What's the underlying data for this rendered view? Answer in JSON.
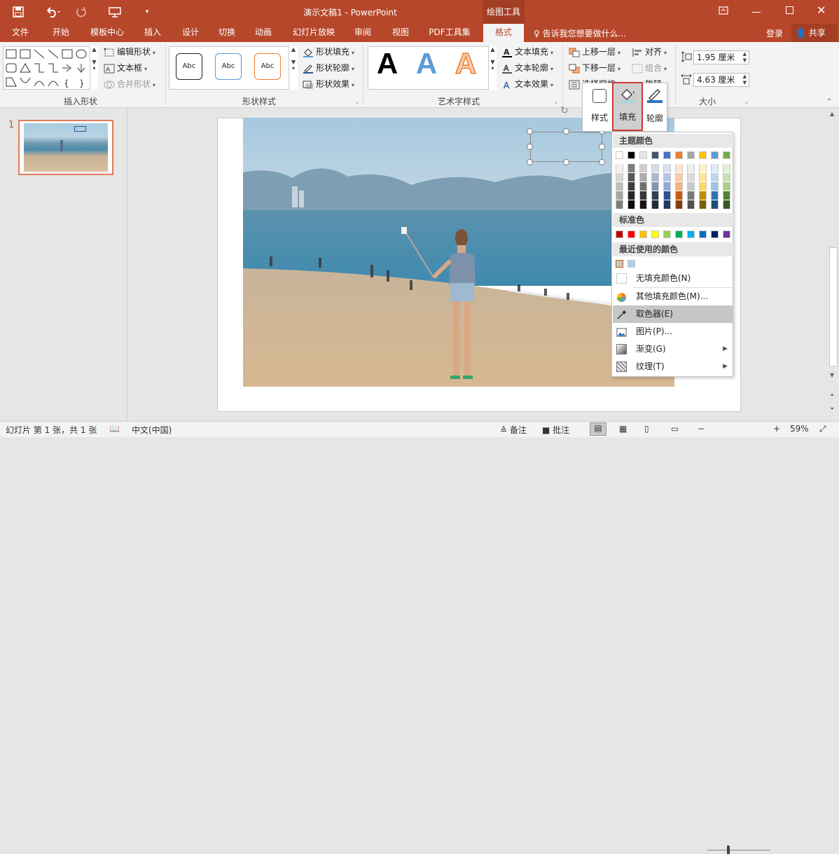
{
  "window": {
    "title": "演示文稿1 - PowerPoint",
    "context_tab": "绘图工具"
  },
  "quick_access": {
    "save": "save-icon",
    "undo": "undo-icon",
    "redo": "redo-icon",
    "present": "present-icon",
    "customize": "customize-icon"
  },
  "tabs": [
    {
      "label": "文件"
    },
    {
      "label": "开始"
    },
    {
      "label": "模板中心"
    },
    {
      "label": "插入"
    },
    {
      "label": "设计"
    },
    {
      "label": "切换"
    },
    {
      "label": "动画"
    },
    {
      "label": "幻灯片放映"
    },
    {
      "label": "审阅"
    },
    {
      "label": "视图"
    },
    {
      "label": "PDF工具集"
    },
    {
      "label": "格式"
    }
  ],
  "tell_me": "告诉我您想要做什么...",
  "account": {
    "login": "登录",
    "share": "共享"
  },
  "ribbon": {
    "insert_shapes": {
      "label": "插入形状",
      "edit_shape": "编辑形状",
      "text_box": "文本框",
      "merge_shapes": "合并形状"
    },
    "shape_styles": {
      "label": "形状样式",
      "sample_text": "Abc",
      "fill": "形状填充",
      "outline": "形状轮廓",
      "effects": "形状效果"
    },
    "wordart": {
      "label": "艺术字样式",
      "letter": "A",
      "text_fill": "文本填充",
      "text_outline": "文本轮廓",
      "text_effects": "文本效果"
    },
    "arrange": {
      "bring_forward": "上移一层",
      "send_backward": "下移一层",
      "selection_pane": "选择窗格",
      "align": "对齐",
      "group": "组合",
      "rotate": "旋转"
    },
    "size": {
      "label": "大小",
      "height": "1.95 厘米",
      "width": "4.63 厘米"
    }
  },
  "slides_pane": {
    "slide_number": "1"
  },
  "mini_toolbar": {
    "style": "样式",
    "fill": "填充",
    "outline": "轮廓"
  },
  "fill_menu": {
    "theme_colors_header": "主题颜色",
    "theme_top_row": [
      "#ffffff",
      "#000000",
      "#e7e6e6",
      "#44546a",
      "#4472c4",
      "#ed7d31",
      "#a5a5a5",
      "#ffc000",
      "#5b9bd5",
      "#70ad47"
    ],
    "theme_tints": [
      [
        "#f2f2f2",
        "#7f7f7f",
        "#d0cece",
        "#d6dce4",
        "#d9e2f3",
        "#fbe5d5",
        "#ededed",
        "#fff2cc",
        "#deebf6",
        "#e2efd9"
      ],
      [
        "#d8d8d8",
        "#595959",
        "#aeabab",
        "#adb9ca",
        "#b4c6e7",
        "#f7cbac",
        "#dbdbdb",
        "#fee599",
        "#bdd7ee",
        "#c5e0b3"
      ],
      [
        "#bfbfbf",
        "#3f3f3f",
        "#757070",
        "#8496b0",
        "#8eaadb",
        "#f4b183",
        "#c9c9c9",
        "#ffd965",
        "#9cc3e5",
        "#a8d08d"
      ],
      [
        "#a5a5a5",
        "#262626",
        "#3a3838",
        "#323f4f",
        "#2f5496",
        "#c55a11",
        "#7b7b7b",
        "#bf9000",
        "#2e75b5",
        "#538135"
      ],
      [
        "#7f7f7f",
        "#0c0c0c",
        "#171616",
        "#222a35",
        "#1f3864",
        "#833c0b",
        "#525252",
        "#7f6000",
        "#1e4e79",
        "#375623"
      ]
    ],
    "standard_header": "标准色",
    "standard_colors": [
      "#c00000",
      "#ff0000",
      "#ffc000",
      "#ffff00",
      "#92d050",
      "#00b050",
      "#00b0f0",
      "#0070c0",
      "#002060",
      "#7030a0"
    ],
    "recent_header": "最近使用的颜色",
    "recent_colors": [
      "#c3c5c7",
      "#a9d4e0"
    ],
    "items": {
      "no_fill": "无填充颜色(N)",
      "more_colors": "其他填充颜色(M)...",
      "eyedropper": "取色器(E)",
      "picture": "图片(P)...",
      "gradient": "渐变(G)",
      "texture": "纹理(T)"
    }
  },
  "status": {
    "slide_info": "幻灯片 第 1 张，共 1 张",
    "language": "中文(中国)",
    "notes": "备注",
    "comments": "批注",
    "zoom": "59%",
    "zoom_level": 0.59
  },
  "colors": {
    "accent": "#b7472a",
    "highlight_border": "#d13438"
  }
}
